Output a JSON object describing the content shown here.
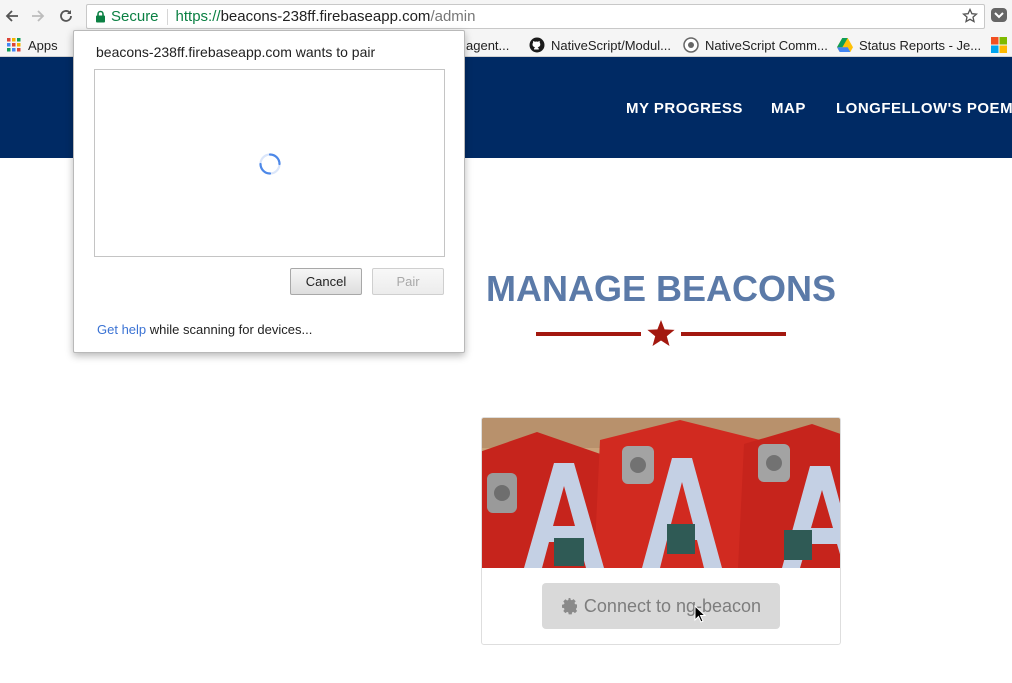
{
  "browser": {
    "secure_label": "Secure",
    "url_scheme": "https://",
    "url_host": "beacons-238ff.firebaseapp.com",
    "url_path": "/admin"
  },
  "bookmarks": [
    {
      "label": "Apps",
      "icon": "apps-grid-icon"
    },
    {
      "label": "agent...",
      "icon": "none"
    },
    {
      "label": "NativeScript/Modul...",
      "icon": "github-icon"
    },
    {
      "label": "NativeScript Comm...",
      "icon": "chat-bubble-icon"
    },
    {
      "label": "Status Reports - Je...",
      "icon": "google-drive-icon"
    }
  ],
  "site_nav": {
    "my_progress": "MY PROGRESS",
    "map": "MAP",
    "poem": "LONGFELLOW'S POEM"
  },
  "page": {
    "title": "MANAGE BEACONS",
    "connect_button": "Connect to ng-beacon"
  },
  "dialog": {
    "title": "beacons-238ff.firebaseapp.com wants to pair",
    "cancel": "Cancel",
    "pair": "Pair",
    "help_link": "Get help",
    "help_text": " while scanning for devices..."
  },
  "colors": {
    "header_bg": "#002a64",
    "title_color": "#5b7aa8",
    "accent_red": "#a3180f",
    "secure_green": "#0b8043",
    "link_blue": "#3b73d4"
  }
}
